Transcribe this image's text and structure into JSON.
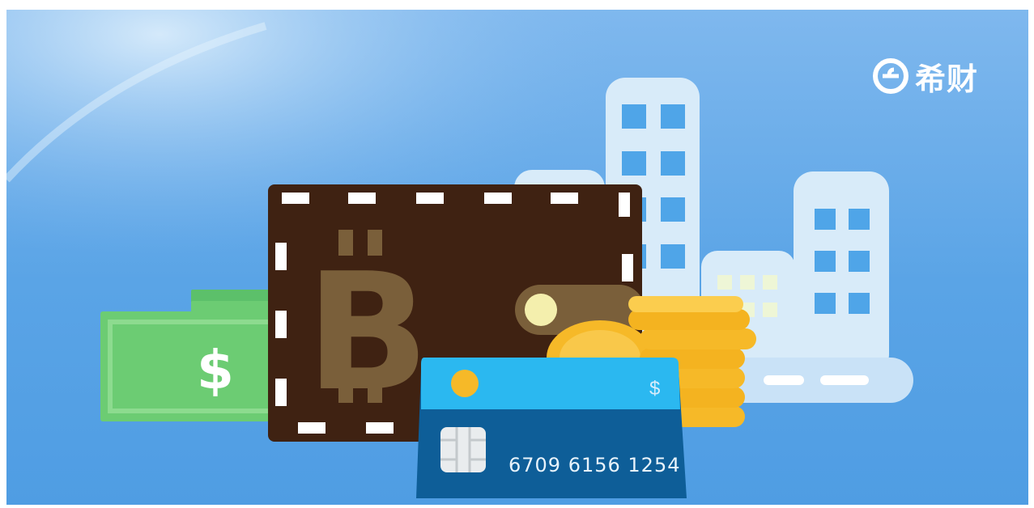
{
  "brand": {
    "logo_text": "希财",
    "logo_icon": "e-circle-icon"
  },
  "illustration": {
    "wallet_symbol": "bitcoin",
    "banknote_symbol": "$",
    "card": {
      "currency_symbol": "$",
      "number": "6709 6156 1254"
    }
  },
  "colors": {
    "background": "#5aa4e6",
    "wallet": "#3f2212",
    "bitcoin": "#7a5f3a",
    "banknote": "#6ccc73",
    "card_top": "#2bb8f0",
    "card_bottom": "#0e5e98",
    "coin": "#f6b928",
    "buildings": "#d8ebf9"
  }
}
